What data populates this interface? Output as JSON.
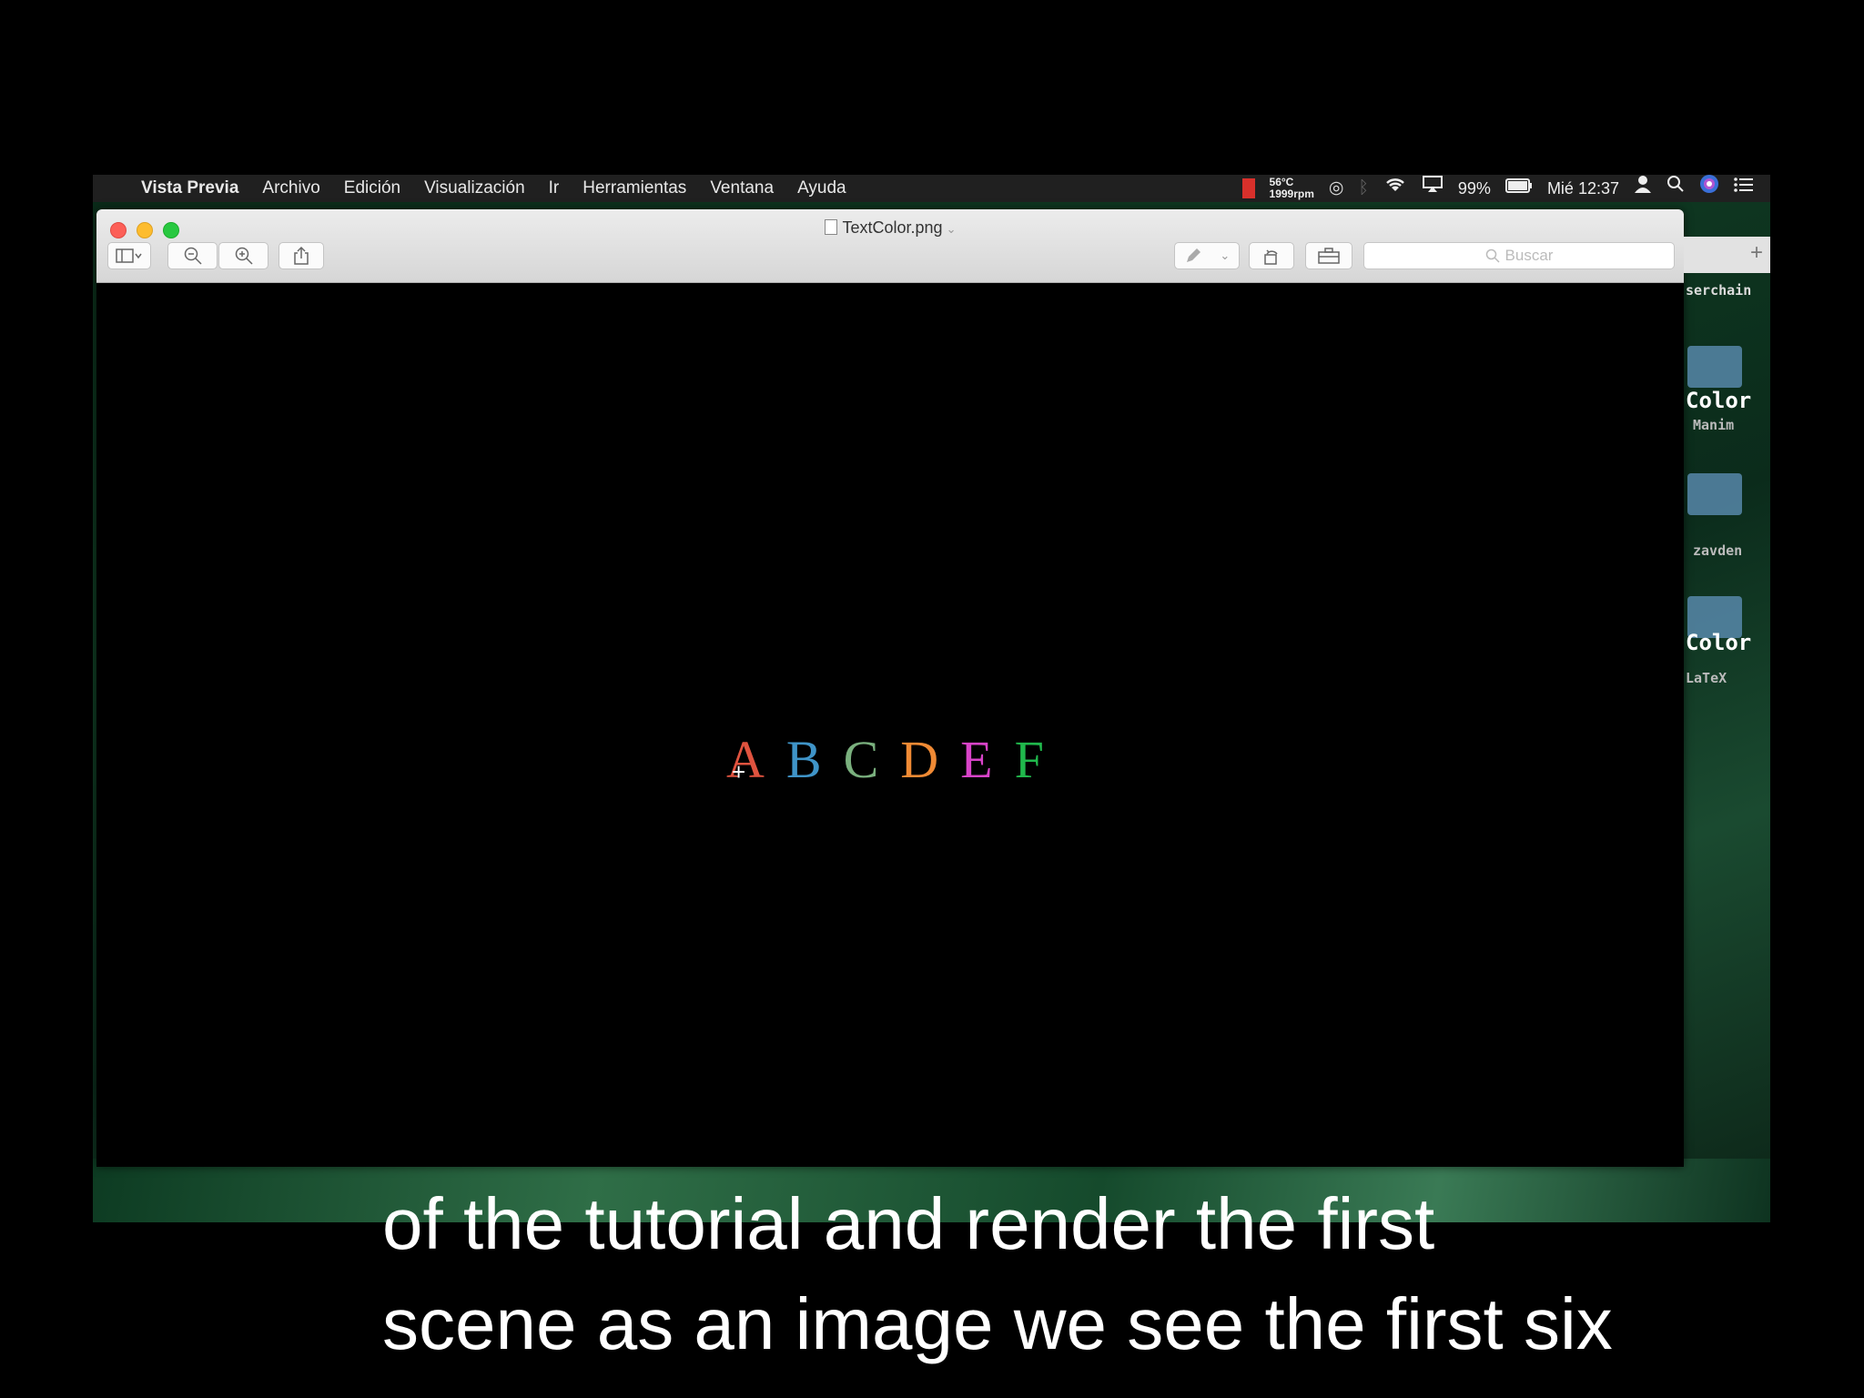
{
  "menubar": {
    "apple_icon": "apple-logo",
    "app_name": "Vista Previa",
    "menus": [
      "Archivo",
      "Edición",
      "Visualización",
      "Ir",
      "Herramientas",
      "Ventana",
      "Ayuda"
    ],
    "status": {
      "temp": "56°C",
      "fan": "1999rpm",
      "battery": "99%",
      "clock": "Mié 12:37"
    }
  },
  "window": {
    "title": "TextColor.png",
    "search_placeholder": "Buscar",
    "image_letters": [
      {
        "char": "A",
        "color": "#e0533f"
      },
      {
        "char": "B",
        "color": "#3f94c8"
      },
      {
        "char": "C",
        "color": "#7ab07e"
      },
      {
        "char": "D",
        "color": "#f08a34"
      },
      {
        "char": "E",
        "color": "#d843c8"
      },
      {
        "char": "F",
        "color": "#20b84c"
      }
    ]
  },
  "desktop": {
    "labels": [
      "serchain",
      "Color",
      "Manim",
      "zavden",
      "Color",
      "LaTeX"
    ]
  },
  "subtitles": {
    "line1": "of the tutorial and render the first",
    "line2": "scene as an image we see the first six"
  }
}
